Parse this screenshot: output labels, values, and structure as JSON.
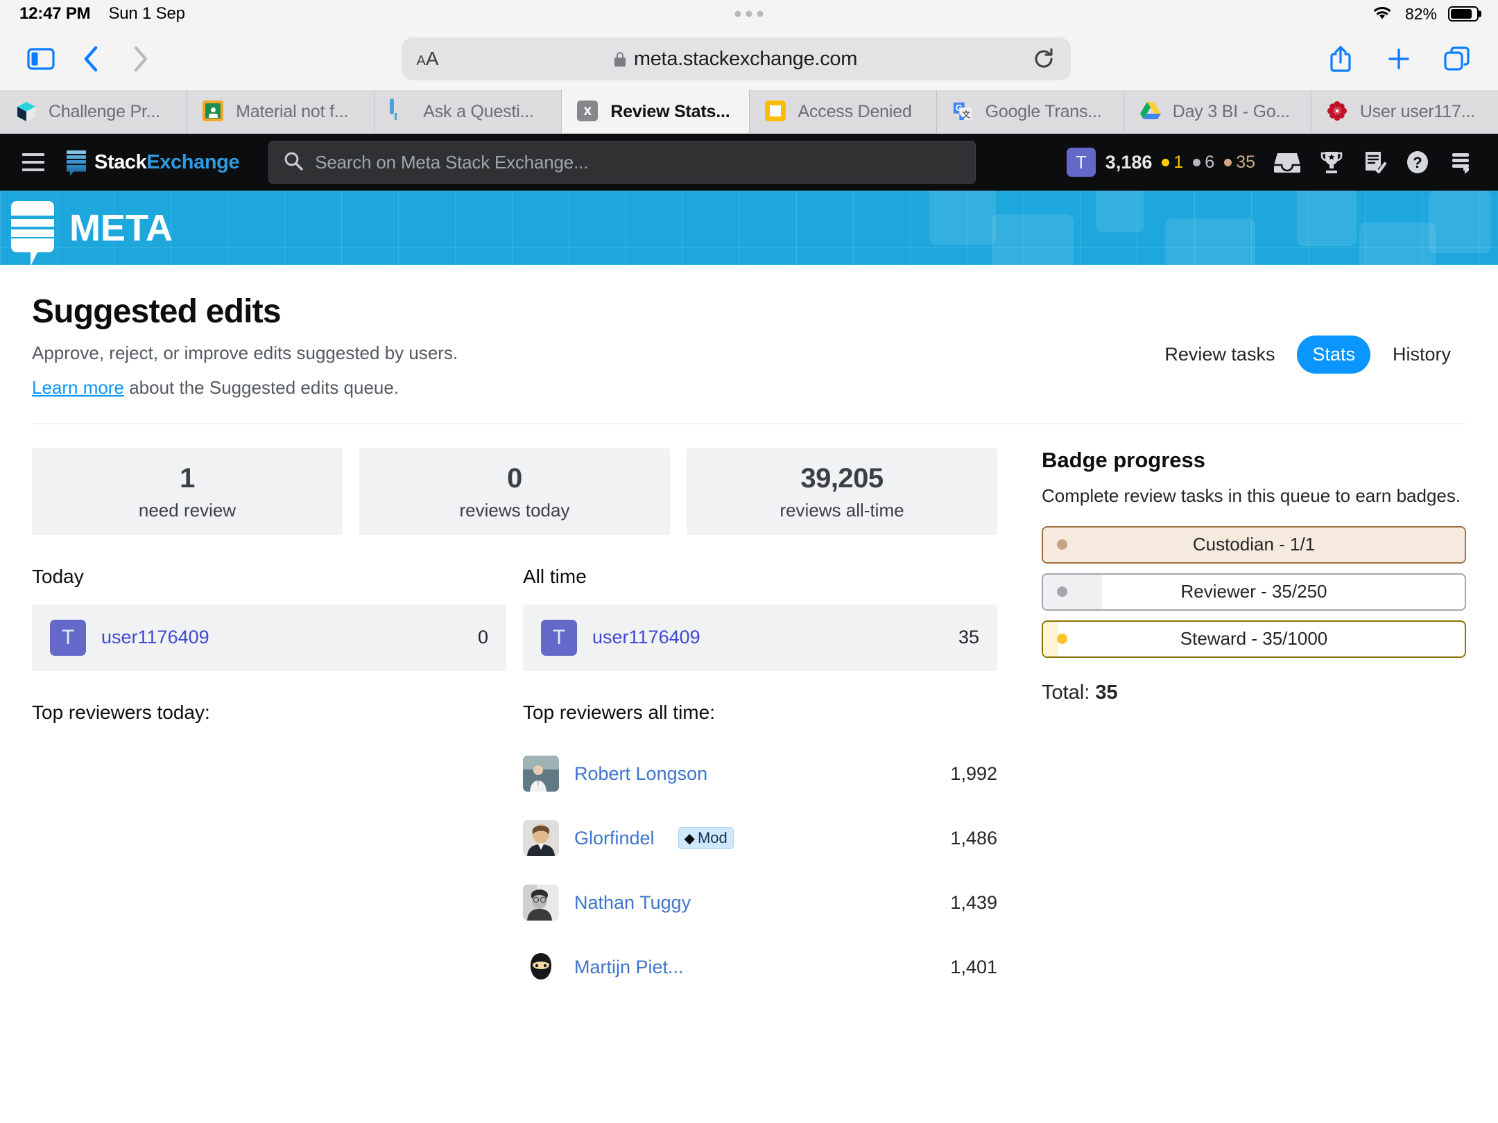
{
  "status_bar": {
    "time": "12:47 PM",
    "date": "Sun 1 Sep",
    "battery_percent": "82%"
  },
  "browser": {
    "text_size_small": "A",
    "text_size_large": "A",
    "url": "meta.stackexchange.com",
    "tabs": [
      {
        "label": "Challenge Pr...",
        "icon": "cube-icon",
        "active": false
      },
      {
        "label": "Material not f...",
        "icon": "google-classroom-icon",
        "active": false
      },
      {
        "label": "Ask a Questi...",
        "icon": "speech-bubble-icon",
        "active": false
      },
      {
        "label": "Review Stats...",
        "icon": "stack-exchange-x-icon",
        "active": true
      },
      {
        "label": "Access Denied",
        "icon": "yellow-square-icon",
        "active": false
      },
      {
        "label": "Google Trans...",
        "icon": "google-translate-icon",
        "active": false
      },
      {
        "label": "Day 3 BI - Go...",
        "icon": "google-drive-icon",
        "active": false
      },
      {
        "label": "User user117...",
        "icon": "red-flower-icon",
        "active": false
      }
    ]
  },
  "se_nav": {
    "logo_stack": "Stack",
    "logo_exchange": "Exchange",
    "search_placeholder": "Search on Meta Stack Exchange...",
    "user": {
      "initial": "T",
      "reputation": "3,186",
      "gold": "1",
      "silver": "6",
      "bronze": "35"
    },
    "icons": [
      "inbox-icon",
      "trophy-icon",
      "review-queue-icon",
      "help-icon",
      "site-switcher-icon"
    ]
  },
  "banner": {
    "site_name": "META"
  },
  "header": {
    "title": "Suggested edits",
    "description": "Approve, reject, or improve edits suggested by users.",
    "learn_more": "Learn more",
    "description_tail": " about the Suggested edits queue.",
    "tabs": [
      {
        "label": "Review tasks",
        "selected": false
      },
      {
        "label": "Stats",
        "selected": true
      },
      {
        "label": "History",
        "selected": false
      }
    ]
  },
  "stats": [
    {
      "value": "1",
      "label": "need review"
    },
    {
      "value": "0",
      "label": "reviews today"
    },
    {
      "value": "39,205",
      "label": "reviews all-time"
    }
  ],
  "today": {
    "heading": "Today",
    "user": {
      "initial": "T",
      "name": "user1176409",
      "count": "0"
    },
    "top_reviewers_label": "Top reviewers today:",
    "reviewers": []
  },
  "all_time": {
    "heading": "All time",
    "user": {
      "initial": "T",
      "name": "user1176409",
      "count": "35"
    },
    "top_reviewers_label": "Top reviewers all time:",
    "reviewers": [
      {
        "name": "Robert Longson",
        "score": "1,992",
        "mod": false
      },
      {
        "name": "Glorfindel",
        "score": "1,486",
        "mod": true,
        "mod_label": "Mod"
      },
      {
        "name": "Nathan Tuggy",
        "score": "1,439",
        "mod": false
      },
      {
        "name": "Martijn Piet...",
        "score": "1,401",
        "mod": false
      }
    ]
  },
  "badge_progress": {
    "heading": "Badge progress",
    "description": "Complete review tasks in this queue to earn badges.",
    "badges": [
      {
        "label": "Custodian - 1/1",
        "tier": "bronze",
        "percent": 100,
        "dot_color": "#c5a383",
        "border_color": "#a0703c",
        "fill_color": "#f6e9dd"
      },
      {
        "label": "Reviewer - 35/250",
        "tier": "silver",
        "percent": 14,
        "dot_color": "#a4a8ab",
        "border_color": "#9fa6ad",
        "fill_color": "#eff0f1"
      },
      {
        "label": "Steward - 35/1000",
        "tier": "gold",
        "percent": 3.5,
        "dot_color": "#fdc42d",
        "border_color": "#8a7400",
        "fill_color": "#fdf4d4"
      }
    ],
    "total_label": "Total:",
    "total_value": "35"
  }
}
